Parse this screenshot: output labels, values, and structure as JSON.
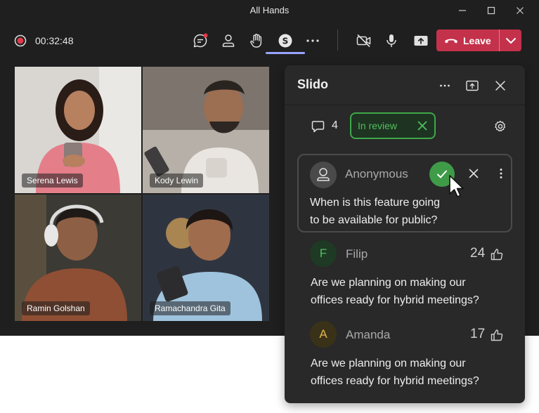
{
  "window": {
    "title": "All Hands"
  },
  "toolbar": {
    "timer": "00:32:48",
    "leave_label": "Leave"
  },
  "participants": [
    {
      "name": "Serena Lewis"
    },
    {
      "name": "Kody Lewin"
    },
    {
      "name": "Ramin Golshan"
    },
    {
      "name": "Ramachandra Gita"
    }
  ],
  "slido": {
    "title": "Slido",
    "question_count": "4",
    "filter_label": "In review",
    "questions": [
      {
        "author": "Anonymous",
        "text_line1": "When is this feature going",
        "text_line2": "to be available for public?"
      },
      {
        "author": "Filip",
        "initial": "F",
        "likes": "24",
        "text_line1": "Are we planning on making our",
        "text_line2": "offices ready for hybrid meetings?"
      },
      {
        "author": "Amanda",
        "initial": "A",
        "likes": "17",
        "text_line1": "Are we planning on making our",
        "text_line2": "offices ready for hybrid meetings?"
      }
    ]
  },
  "colors": {
    "leave": "#c4314b",
    "approve": "#3f9b48",
    "review_border": "#3fa84b",
    "active_tab": "#9aa4ff",
    "avatar_f": "#1e3a24",
    "avatar_a": "#3a3218"
  }
}
